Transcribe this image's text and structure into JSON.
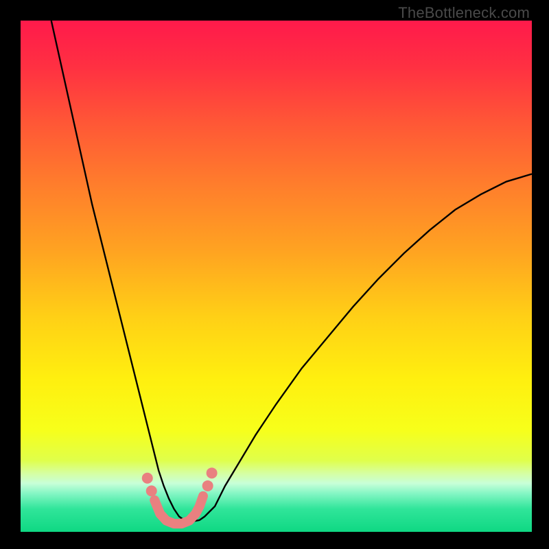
{
  "watermark": "TheBottleneck.com",
  "chart_data": {
    "type": "line",
    "title": "",
    "xlabel": "",
    "ylabel": "",
    "xlim": [
      0,
      100
    ],
    "ylim": [
      0,
      100
    ],
    "grid": false,
    "legend": false,
    "background_gradient": [
      {
        "stop": 0.0,
        "color": "#ff1a4b"
      },
      {
        "stop": 0.09,
        "color": "#ff3042"
      },
      {
        "stop": 0.2,
        "color": "#ff5736"
      },
      {
        "stop": 0.32,
        "color": "#ff7d2c"
      },
      {
        "stop": 0.45,
        "color": "#ffa321"
      },
      {
        "stop": 0.58,
        "color": "#ffd016"
      },
      {
        "stop": 0.7,
        "color": "#ffef0f"
      },
      {
        "stop": 0.8,
        "color": "#f7ff1a"
      },
      {
        "stop": 0.86,
        "color": "#e0ff4a"
      },
      {
        "stop": 0.885,
        "color": "#d6ffa0"
      },
      {
        "stop": 0.905,
        "color": "#c8ffd8"
      },
      {
        "stop": 0.925,
        "color": "#84f6c4"
      },
      {
        "stop": 0.955,
        "color": "#30e59a"
      },
      {
        "stop": 1.0,
        "color": "#0fd883"
      }
    ],
    "series": [
      {
        "name": "bottleneck-curve",
        "stroke": "#000000",
        "stroke_width": 2.4,
        "x": [
          6,
          8,
          10,
          12,
          14,
          16,
          18,
          20,
          22,
          24,
          25,
          26,
          27,
          28,
          29,
          30,
          31,
          32,
          33,
          34,
          35,
          36,
          38,
          40,
          43,
          46,
          50,
          55,
          60,
          65,
          70,
          75,
          80,
          85,
          90,
          95,
          100
        ],
        "y": [
          100,
          91,
          82,
          73,
          64,
          56,
          48,
          40,
          32,
          24,
          20,
          16,
          12,
          9,
          6.5,
          4.5,
          3,
          2.3,
          2.1,
          2.1,
          2.3,
          3,
          5,
          9,
          14,
          19,
          25,
          32,
          38,
          44,
          49.5,
          54.5,
          59,
          63,
          66,
          68.5,
          70
        ]
      },
      {
        "name": "marker-pill",
        "stroke": "#e98080",
        "stroke_width": 14,
        "linecap": "round",
        "x": [
          26.2,
          27.3,
          28.5,
          30,
          31.5,
          33,
          34.2,
          35,
          35.7
        ],
        "y": [
          6.2,
          3.5,
          2.2,
          1.6,
          1.6,
          2.2,
          3.5,
          5.0,
          7.0
        ]
      },
      {
        "name": "marker-dot-left-upper",
        "type": "point",
        "fill": "#e98080",
        "r": 8,
        "x": [
          24.8
        ],
        "y": [
          10.5
        ]
      },
      {
        "name": "marker-dot-left-lower",
        "type": "point",
        "fill": "#e98080",
        "r": 8,
        "x": [
          25.6
        ],
        "y": [
          8.0
        ]
      },
      {
        "name": "marker-dot-right-lower",
        "type": "point",
        "fill": "#e98080",
        "r": 8,
        "x": [
          36.6
        ],
        "y": [
          9.0
        ]
      },
      {
        "name": "marker-dot-right-upper",
        "type": "point",
        "fill": "#e98080",
        "r": 8,
        "x": [
          37.4
        ],
        "y": [
          11.5
        ]
      }
    ]
  }
}
